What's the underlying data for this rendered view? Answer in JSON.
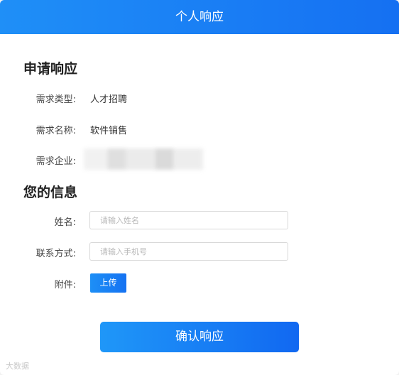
{
  "dialog": {
    "title": "个人响应"
  },
  "request_section": {
    "title": "申请响应",
    "rows": [
      {
        "label": "需求类型:",
        "value": "人才招聘"
      },
      {
        "label": "需求名称:",
        "value": "软件销售"
      },
      {
        "label": "需求企业:",
        "value": ""
      }
    ]
  },
  "info_section": {
    "title": "您的信息",
    "name": {
      "label": "姓名:",
      "placeholder": "请输入姓名",
      "value": ""
    },
    "contact": {
      "label": "联系方式:",
      "placeholder": "请输入手机号",
      "value": ""
    },
    "attachment": {
      "label": "附件:",
      "button_label": "上传"
    }
  },
  "actions": {
    "confirm_label": "确认响应"
  },
  "watermark": "大数据"
}
